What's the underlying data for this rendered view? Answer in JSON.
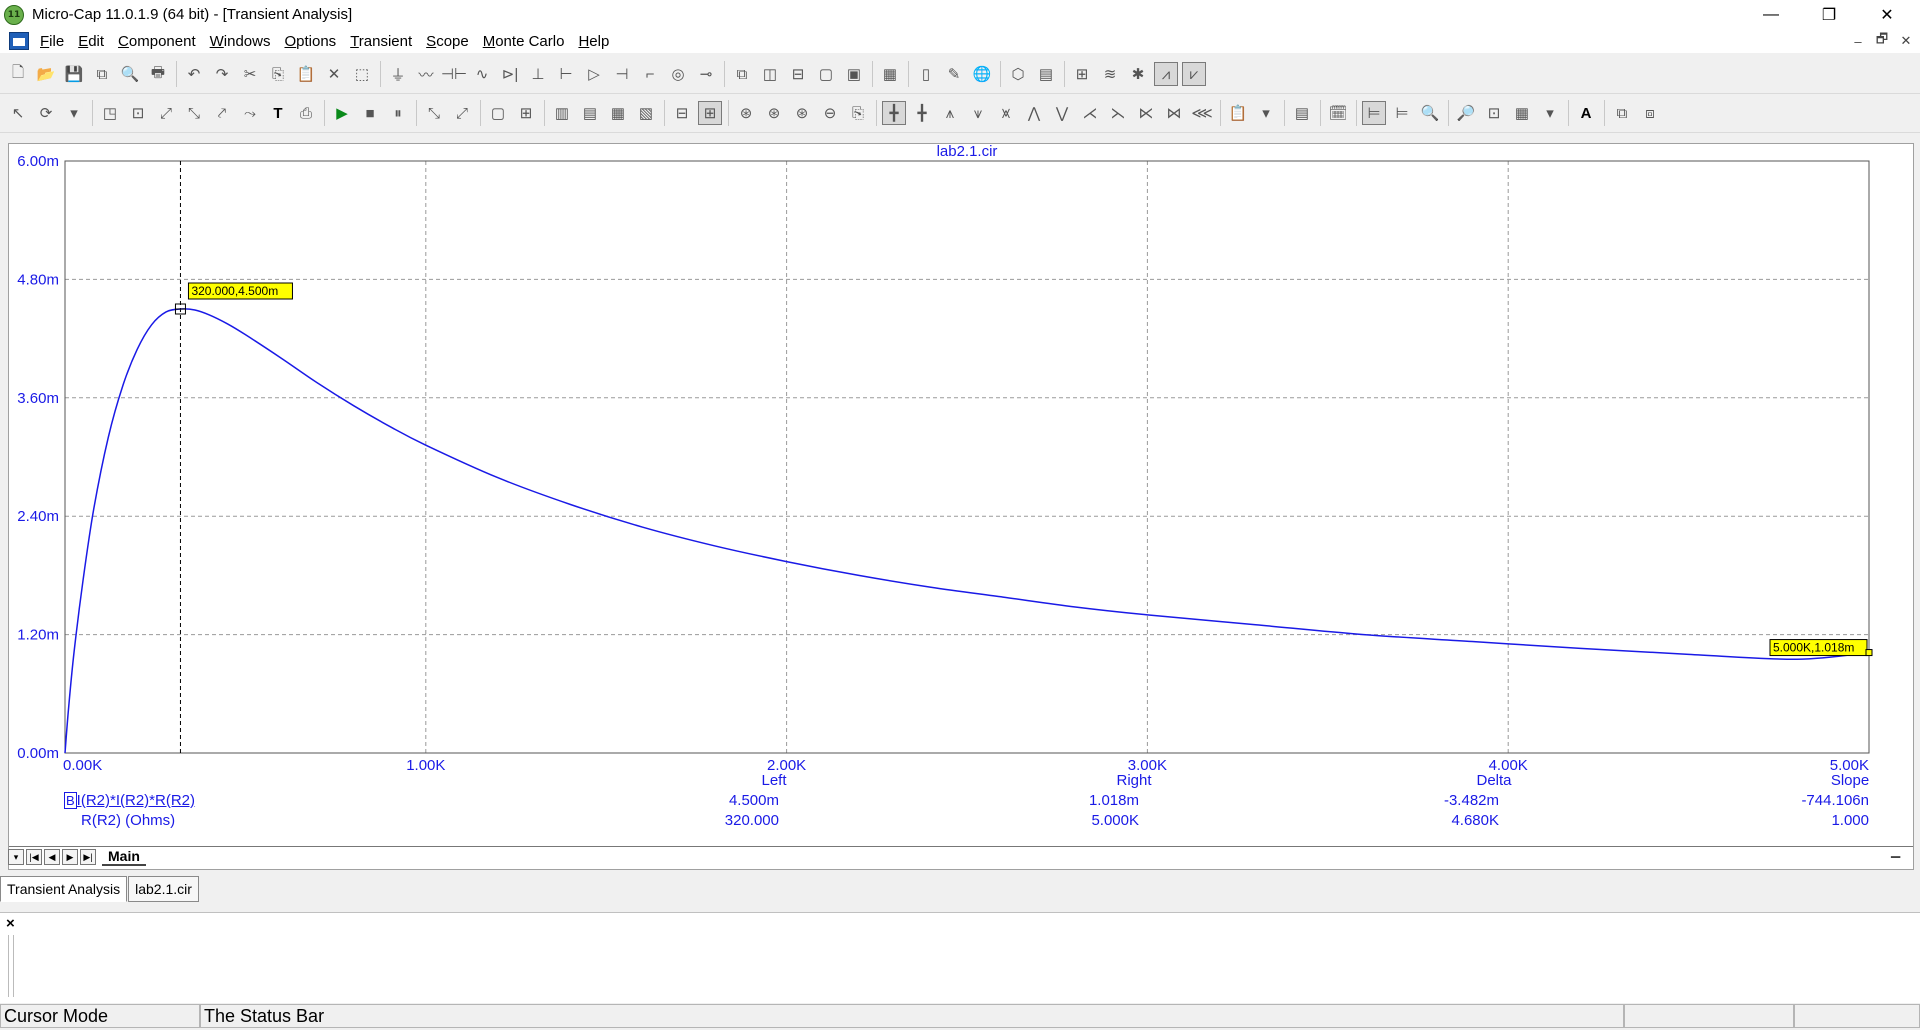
{
  "window": {
    "title": "Micro-Cap 11.0.1.9 (64 bit) - [Transient Analysis]",
    "app_icon_text": "11",
    "controls": {
      "minimize": "—",
      "restore": "❐",
      "close": "✕"
    }
  },
  "menu": {
    "items": [
      "File",
      "Edit",
      "Component",
      "Windows",
      "Options",
      "Transient",
      "Scope",
      "Monte Carlo",
      "Help"
    ],
    "mdi_controls": {
      "minimize": "–",
      "restore": "🗗",
      "close": "✕"
    }
  },
  "toolbar1": {
    "icons": [
      "new-file-icon",
      "open-folder-icon",
      "save-icon",
      "save-all-icon",
      "print-preview-icon",
      "print-icon",
      "undo-icon",
      "redo-icon",
      "cut-icon",
      "copy-icon",
      "paste-icon",
      "delete-icon",
      "select-all-icon",
      "ground-icon",
      "resistor-icon",
      "capacitor-icon",
      "inductor-icon",
      "diode-icon",
      "transistor-icon",
      "npn-icon",
      "opamp-icon",
      "battery-icon",
      "switch-icon",
      "source-icon",
      "probe-icon",
      "cascade-icon",
      "tile-vertical-icon",
      "tile-horizontal-icon",
      "window-icon",
      "maximize-window-icon",
      "calculator-icon",
      "page-icon",
      "component-editor-icon",
      "globe-icon",
      "shape-editor-icon",
      "package-editor-icon",
      "model-icon",
      "wizard-icon",
      "tools-icon",
      "analysis-icon",
      "dynamic-icon"
    ],
    "glyphs": [
      "🗋",
      "📂",
      "💾",
      "⧉",
      "🔍",
      "🖶",
      "↶",
      "↷",
      "✂",
      "⎘",
      "📋",
      "✕",
      "⬚",
      "⏚",
      "〰",
      "⊣⊢",
      "∿",
      "⊳|",
      "⊥",
      "⊢",
      "▷",
      "⊣",
      "⌐",
      "◎",
      "⊸",
      "⧉",
      "◫",
      "⊟",
      "▢",
      "▣",
      "▦",
      "▯",
      "✎",
      "🌐",
      "⬡",
      "▤",
      "⊞",
      "≋",
      "✱",
      "⩘",
      "⩗"
    ]
  },
  "toolbar2": {
    "glyphs": [
      "↖",
      "⟳",
      "▾",
      "◳",
      "⊡",
      "⤢",
      "⤡",
      "⤤",
      "⤳",
      "T",
      "⎙",
      "▶",
      "■",
      "⏸",
      "⤡",
      "⤢",
      "▢",
      "⊞",
      "▥",
      "▤",
      "▦",
      "▧",
      "⊟",
      "⊞",
      "⊛",
      "⊛",
      "⊛",
      "⊖",
      "⎘",
      "╋",
      "╋",
      "⩚",
      "⩛",
      "⩙",
      "⋀",
      "⋁",
      "⋌",
      "⋋",
      "⋉",
      "⋈",
      "⋘",
      "📋",
      "▾",
      "▤",
      "🗓",
      "⊨",
      "⊨",
      "🔍",
      "🔎",
      "⊡",
      "▦",
      "▾",
      "A",
      "⧉",
      "⧈"
    ],
    "icons": [
      "select-arrow-icon",
      "redraw-icon",
      "dropdown-arrow-icon",
      "scale-icon",
      "auto-scale-icon",
      "zoom-fit-icon",
      "zoom-region-icon",
      "x-range-icon",
      "y-range-icon",
      "text-icon",
      "export-icon",
      "run-icon",
      "stop-icon",
      "pause-icon",
      "performance-icon",
      "fft-icon",
      "frame-icon",
      "grid-icon",
      "plot-1-icon",
      "plot-2-icon",
      "plot-3-icon",
      "plot-4-icon",
      "tokens-icon",
      "cursor-icon",
      "go-peak-icon",
      "go-valley-icon",
      "go-high-icon",
      "go-low-icon",
      "options-icon",
      "horizontal-cursor-icon",
      "vertical-cursor-icon",
      "peak-icon",
      "valley-icon",
      "high-icon",
      "low-icon",
      "inflection-icon",
      "global-high-icon",
      "global-low-icon",
      "slope-icon",
      "cross-icon",
      "tag-icon",
      "clipboard-icon",
      "dropdown-arrow-icon",
      "properties-icon",
      "calendar-icon",
      "align-icon",
      "align2-icon",
      "zoom-in-icon",
      "zoom-out-icon",
      "pan-icon",
      "layout-icon",
      "dropdown-arrow-icon",
      "font-icon",
      "copy-plot-icon",
      "paste-plot-icon"
    ]
  },
  "chart_data": {
    "type": "line",
    "title": "lab2.1.cir",
    "x_tick_labels": [
      "0.00K",
      "1.00K",
      "2.00K",
      "3.00K",
      "4.00K",
      "5.00K"
    ],
    "y_tick_labels": [
      "6.00m",
      "4.80m",
      "3.60m",
      "2.40m",
      "1.20m",
      "0.00m"
    ],
    "xlim": [
      0,
      5000
    ],
    "ylim": [
      0,
      0.006
    ],
    "grid": true,
    "series": [
      {
        "name": "I(R2)*I(R2)*R(R2)",
        "color": "#1a1ae6",
        "x": [
          0,
          10,
          25,
          50,
          80,
          120,
          160,
          200,
          240,
          280,
          320,
          360,
          400,
          450,
          500,
          600,
          700,
          800,
          900,
          1000,
          1200,
          1400,
          1600,
          1800,
          2000,
          2200,
          2400,
          2600,
          2800,
          3000,
          3300,
          3600,
          3900,
          4200,
          4500,
          4800,
          5000
        ],
        "y": [
          0.0,
          0.000458,
          0.00102,
          0.00175,
          0.00248,
          0.0032,
          0.00372,
          0.00409,
          0.00434,
          0.00447,
          0.0045,
          0.00449,
          0.00444,
          0.00435,
          0.00424,
          0.004,
          0.00375,
          0.00352,
          0.00331,
          0.00312,
          0.00279,
          0.00252,
          0.00229,
          0.0021,
          0.00194,
          0.0018,
          0.00168,
          0.00158,
          0.00148,
          0.0014,
          0.0013,
          0.0012,
          0.00113,
          0.00106,
          0.001,
          0.00095,
          0.001018
        ]
      }
    ],
    "cursor_tags": [
      {
        "label": "320.000,4.500m",
        "x": 320,
        "y": 0.0045
      },
      {
        "label": "5.000K,1.018m",
        "x": 5000,
        "y": 0.001018
      }
    ],
    "left_cursor_x": 320,
    "legend_position": "bottom",
    "table": {
      "headers": {
        "left": "Left",
        "right": "Right",
        "delta": "Delta",
        "slope": "Slope"
      },
      "rows": [
        {
          "label": "I(R2)*I(R2)*R(R2)",
          "marker": "B",
          "left": "4.500m",
          "right": "1.018m",
          "delta": "-3.482m",
          "slope": "-744.106n"
        },
        {
          "label": "R(R2) (Ohms)",
          "left": "320.000",
          "right": "5.000K",
          "delta": "4.680K",
          "slope": "1.000"
        }
      ]
    }
  },
  "plot_tabs": {
    "nav": [
      "▾",
      "|◀",
      "◀",
      "▶",
      "▶|"
    ],
    "active": "Main"
  },
  "window_tabs": [
    "Transient Analysis",
    "lab2.1.cir"
  ],
  "output": {
    "close": "×"
  },
  "status": {
    "mode": "Cursor Mode",
    "message": "The Status Bar"
  }
}
